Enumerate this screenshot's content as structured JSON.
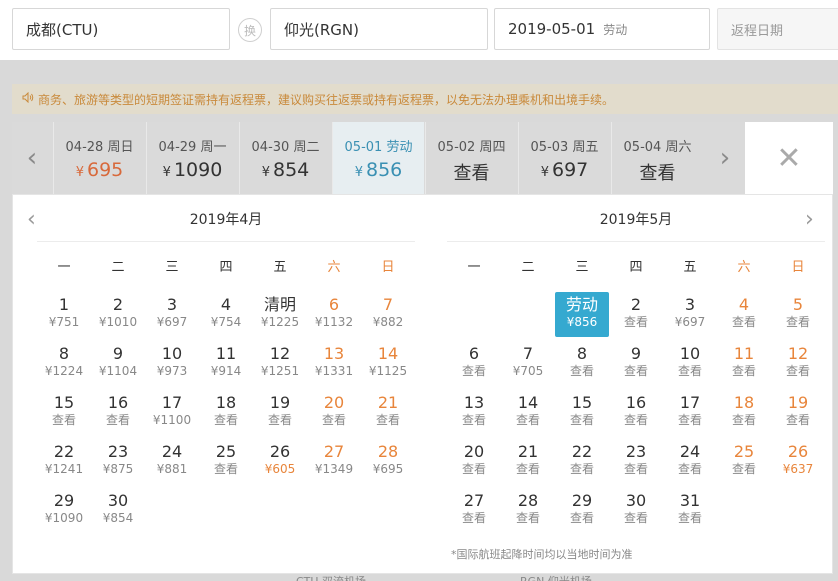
{
  "search": {
    "from": "成都(CTU)",
    "swap": "换",
    "to": "仰光(RGN)",
    "date": "2019-05-01",
    "date_tag": "劳动",
    "return_placeholder": "返程日期"
  },
  "notice": {
    "text": "商务、旅游等类型的短期签证需持有返程票，建议购买往返票或持有返程票，以免无法办理乘机和出境手续。"
  },
  "strip": {
    "items": [
      {
        "date": "04-28 周日",
        "yen": "¥",
        "price": "695",
        "state": "low"
      },
      {
        "date": "04-29 周一",
        "yen": "¥",
        "price": "1090",
        "state": ""
      },
      {
        "date": "04-30 周二",
        "yen": "¥",
        "price": "854",
        "state": ""
      },
      {
        "date": "05-01 劳动",
        "yen": "¥",
        "price": "856",
        "state": "sel"
      },
      {
        "date": "05-02 周四",
        "yen": "",
        "price": "查看",
        "state": "look"
      },
      {
        "date": "05-03 周五",
        "yen": "¥",
        "price": "697",
        "state": ""
      },
      {
        "date": "05-04 周六",
        "yen": "",
        "price": "查看",
        "state": "look"
      }
    ]
  },
  "calendar": {
    "weekdays": [
      "一",
      "二",
      "三",
      "四",
      "五",
      "六",
      "日"
    ],
    "months": [
      {
        "title": "2019年4月",
        "days": [
          {
            "n": "1",
            "s": "¥751"
          },
          {
            "n": "2",
            "s": "¥1010"
          },
          {
            "n": "3",
            "s": "¥697"
          },
          {
            "n": "4",
            "s": "¥754"
          },
          {
            "n": "清明",
            "s": "¥1225"
          },
          {
            "n": "6",
            "s": "¥1132"
          },
          {
            "n": "7",
            "s": "¥882"
          },
          {
            "n": "8",
            "s": "¥1224"
          },
          {
            "n": "9",
            "s": "¥1104"
          },
          {
            "n": "10",
            "s": "¥973"
          },
          {
            "n": "11",
            "s": "¥914"
          },
          {
            "n": "12",
            "s": "¥1251"
          },
          {
            "n": "13",
            "s": "¥1331"
          },
          {
            "n": "14",
            "s": "¥1125"
          },
          {
            "n": "15",
            "s": "查看"
          },
          {
            "n": "16",
            "s": "查看"
          },
          {
            "n": "17",
            "s": "¥1100"
          },
          {
            "n": "18",
            "s": "查看"
          },
          {
            "n": "19",
            "s": "查看"
          },
          {
            "n": "20",
            "s": "查看"
          },
          {
            "n": "21",
            "s": "查看"
          },
          {
            "n": "22",
            "s": "¥1241"
          },
          {
            "n": "23",
            "s": "¥875"
          },
          {
            "n": "24",
            "s": "¥881"
          },
          {
            "n": "25",
            "s": "查看"
          },
          {
            "n": "26",
            "s": "¥605",
            "low": true
          },
          {
            "n": "27",
            "s": "¥1349"
          },
          {
            "n": "28",
            "s": "¥695"
          },
          {
            "n": "29",
            "s": "¥1090"
          },
          {
            "n": "30",
            "s": "¥854"
          }
        ]
      },
      {
        "title": "2019年5月",
        "days": [
          {
            "n": "劳动",
            "s": "¥856",
            "sel": true
          },
          {
            "n": "2",
            "s": "查看"
          },
          {
            "n": "3",
            "s": "¥697"
          },
          {
            "n": "4",
            "s": "查看"
          },
          {
            "n": "5",
            "s": "查看"
          },
          {
            "n": "6",
            "s": "查看"
          },
          {
            "n": "7",
            "s": "¥705"
          },
          {
            "n": "8",
            "s": "查看"
          },
          {
            "n": "9",
            "s": "查看"
          },
          {
            "n": "10",
            "s": "查看"
          },
          {
            "n": "11",
            "s": "查看"
          },
          {
            "n": "12",
            "s": "查看"
          },
          {
            "n": "13",
            "s": "查看"
          },
          {
            "n": "14",
            "s": "查看"
          },
          {
            "n": "15",
            "s": "查看"
          },
          {
            "n": "16",
            "s": "查看"
          },
          {
            "n": "17",
            "s": "查看"
          },
          {
            "n": "18",
            "s": "查看"
          },
          {
            "n": "19",
            "s": "查看"
          },
          {
            "n": "20",
            "s": "查看"
          },
          {
            "n": "21",
            "s": "查看"
          },
          {
            "n": "22",
            "s": "查看"
          },
          {
            "n": "23",
            "s": "查看"
          },
          {
            "n": "24",
            "s": "查看"
          },
          {
            "n": "25",
            "s": "查看"
          },
          {
            "n": "26",
            "s": "¥637",
            "low": true
          },
          {
            "n": "27",
            "s": "查看"
          },
          {
            "n": "28",
            "s": "查看"
          },
          {
            "n": "29",
            "s": "查看"
          },
          {
            "n": "30",
            "s": "查看"
          },
          {
            "n": "31",
            "s": "查看"
          }
        ]
      }
    ],
    "footnote": "*国际航班起降时间均以当地时间为准"
  },
  "bottom": {
    "left": "CTU 双流机场",
    "right": "RGN 仰光机场"
  },
  "icons": {
    "strip_prev": "chevron-left-icon",
    "strip_next": "chevron-right-icon",
    "close": "close-icon",
    "notice": "speaker-icon"
  }
}
